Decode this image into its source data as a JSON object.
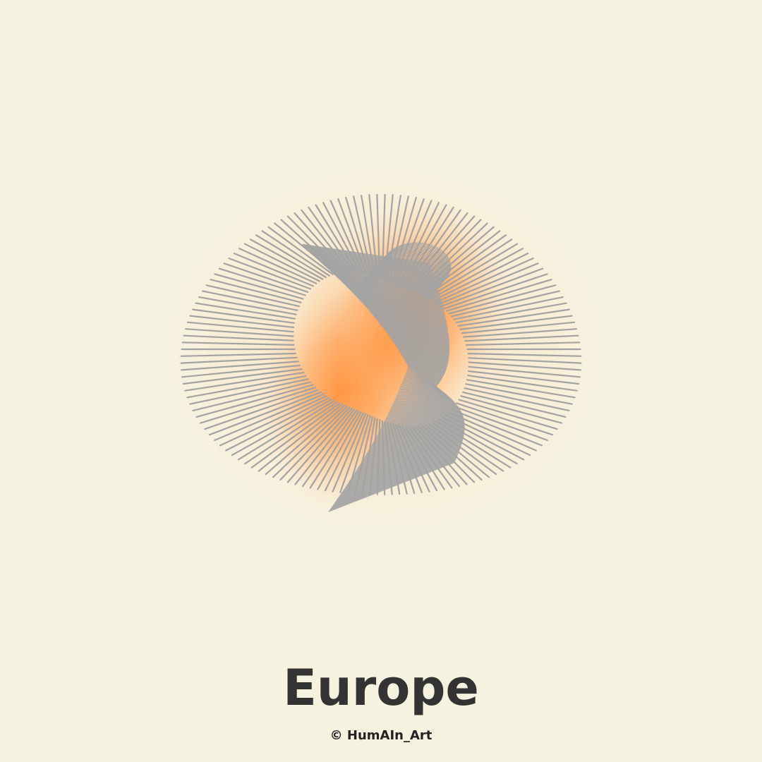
{
  "artwork": {
    "name": "europe-ribbon-sphere",
    "colors": {
      "background": "#f6f2e0",
      "glow": "#ff8a30",
      "lines": "#a3a3a3",
      "text": "#333333"
    }
  },
  "caption": {
    "title": "Europe",
    "credit": "© HumAIn_Art"
  }
}
